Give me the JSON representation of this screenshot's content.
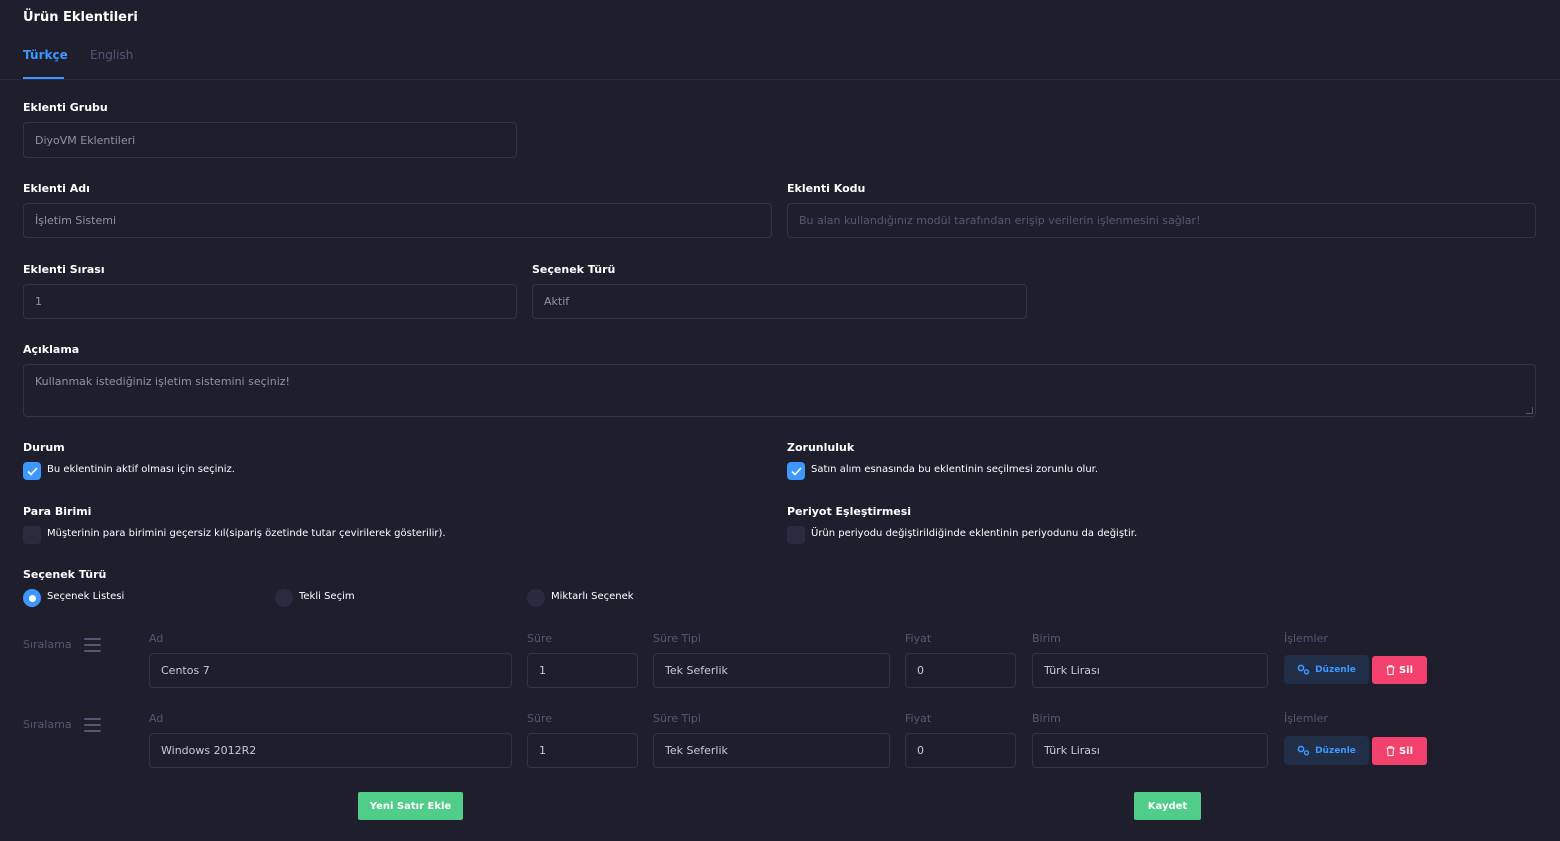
{
  "title": "Ürün Eklentileri",
  "tabs": [
    {
      "label": "Türkçe",
      "active": true
    },
    {
      "label": "English",
      "active": false
    }
  ],
  "form": {
    "group": {
      "label": "Eklenti Grubu",
      "value": "DiyoVM Eklentileri"
    },
    "name": {
      "label": "Eklenti Adı",
      "value": "İşletim Sistemi"
    },
    "code": {
      "label": "Eklenti Kodu",
      "placeholder": "Bu alan kullandığınız modül tarafından erişip verilerin işlenmesini sağlar!"
    },
    "order": {
      "label": "Eklenti Sırası",
      "value": "1"
    },
    "option_type_field": {
      "label": "Seçenek Türü",
      "value": "Aktif"
    },
    "description": {
      "label": "Açıklama",
      "value": "Kullanmak istediğiniz işletim sistemini seçiniz!"
    },
    "status": {
      "label": "Durum",
      "text": "Bu eklentinin aktif olması için seçiniz.",
      "checked": true
    },
    "required": {
      "label": "Zorunluluk",
      "text": "Satın alım esnasında bu eklentinin seçilmesi zorunlu olur.",
      "checked": true
    },
    "currency": {
      "label": "Para Birimi",
      "text": "Müşterinin para birimini geçersiz kıl(sipariş özetinde tutar çevirilerek gösterilir).",
      "checked": false
    },
    "period": {
      "label": "Periyot Eşleştirmesi",
      "text": "Ürün periyodu değiştirildiğinde eklentinin periyodunu da değiştir.",
      "checked": false
    },
    "option_type": {
      "label": "Seçenek Türü",
      "options": [
        {
          "label": "Seçenek Listesi",
          "selected": true
        },
        {
          "label": "Tekli Seçim",
          "selected": false
        },
        {
          "label": "Miktarlı Seçenek",
          "selected": false
        }
      ]
    }
  },
  "table": {
    "columns": {
      "sort": "Sıralama",
      "name": "Ad",
      "duration": "Süre",
      "duration_type": "Süre Tipi",
      "price": "Fiyat",
      "unit": "Birim",
      "actions": "İşlemler"
    },
    "rows": [
      {
        "name": "Centos 7",
        "duration": "1",
        "duration_type": "Tek Seferlik",
        "price": "0",
        "unit": "Türk Lirası"
      },
      {
        "name": "Windows 2012R2",
        "duration": "1",
        "duration_type": "Tek Seferlik",
        "price": "0",
        "unit": "Türk Lirası"
      }
    ],
    "edit_label": "Düzenle",
    "delete_label": "Sil"
  },
  "buttons": {
    "add_row": "Yeni Satır Ekle",
    "save": "Kaydet"
  },
  "colors": {
    "background": "#1e1e2d",
    "primary": "#3e97ff",
    "danger": "#f1416c",
    "success": "#50cd89"
  }
}
